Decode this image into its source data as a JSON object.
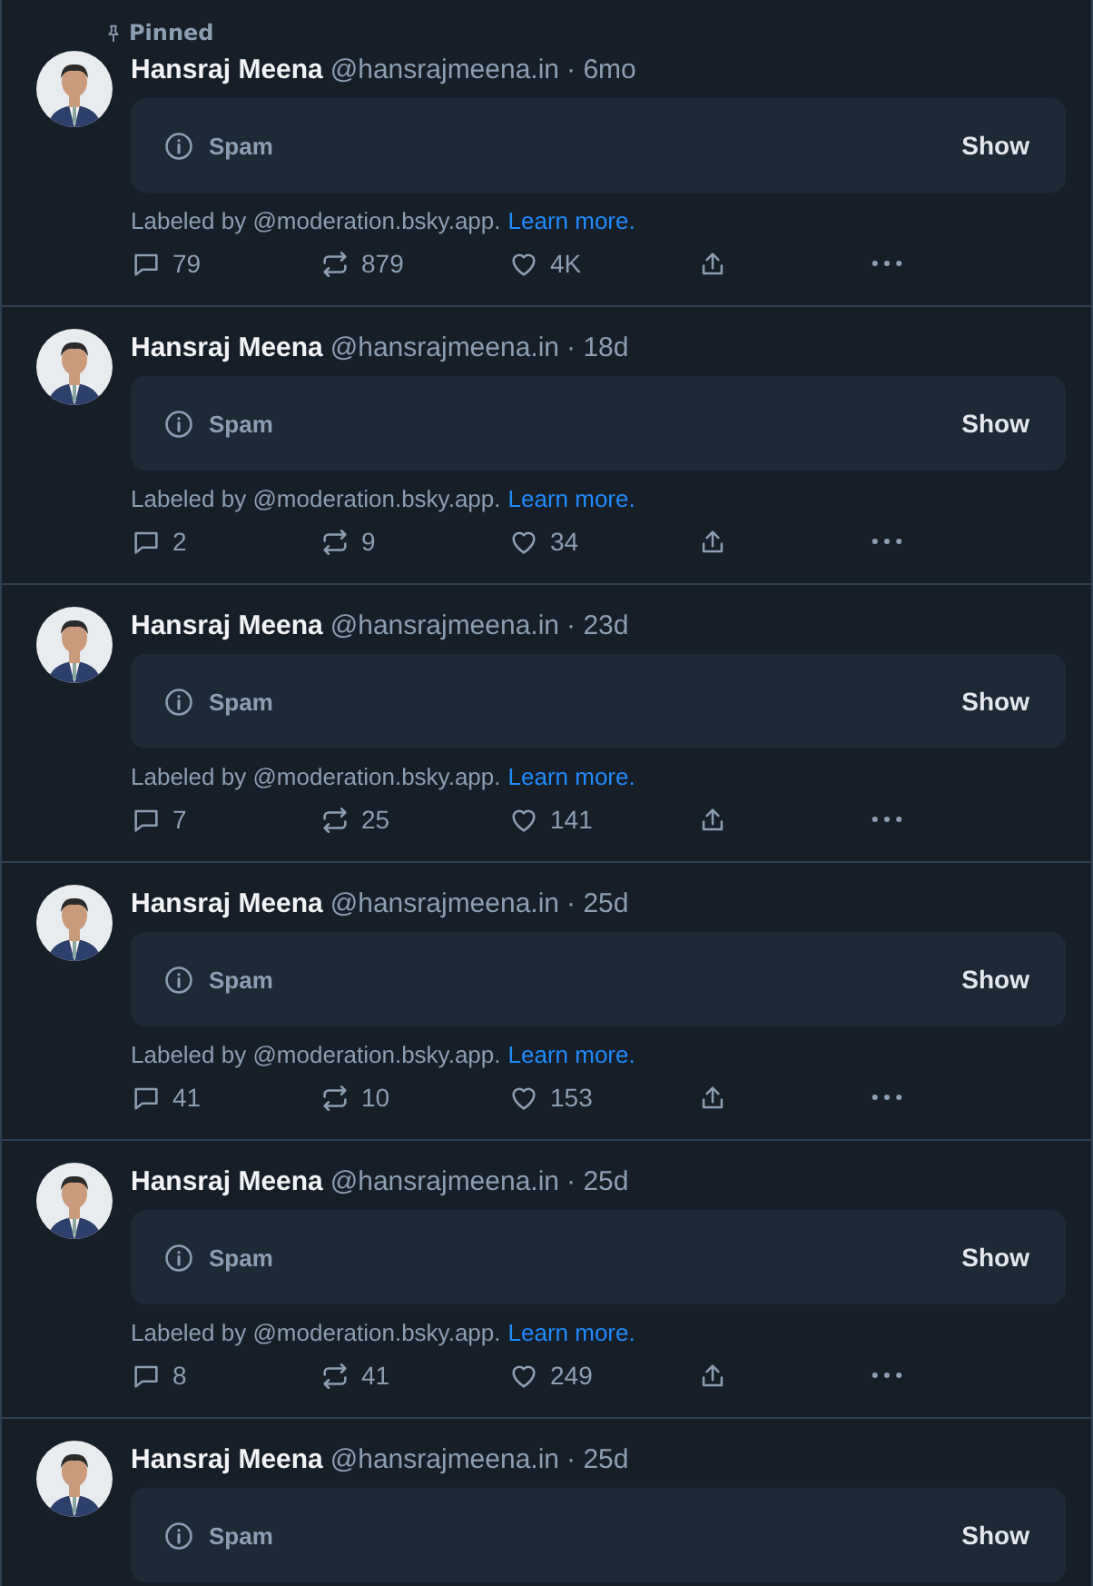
{
  "posts": [
    {
      "pinned_label": "Pinned",
      "name": "Hansraj Meena",
      "handle": "@hansrajmeena.in",
      "time": "· 6mo",
      "warning": "Spam",
      "show": "Show",
      "labeled_by": "Labeled by @moderation.bsky.app.",
      "learn_more": "Learn more.",
      "replies": "79",
      "reposts": "879",
      "likes": "4K"
    },
    {
      "name": "Hansraj Meena",
      "handle": "@hansrajmeena.in",
      "time": "· 18d",
      "warning": "Spam",
      "show": "Show",
      "labeled_by": "Labeled by @moderation.bsky.app.",
      "learn_more": "Learn more.",
      "replies": "2",
      "reposts": "9",
      "likes": "34"
    },
    {
      "name": "Hansraj Meena",
      "handle": "@hansrajmeena.in",
      "time": "· 23d",
      "warning": "Spam",
      "show": "Show",
      "labeled_by": "Labeled by @moderation.bsky.app.",
      "learn_more": "Learn more.",
      "replies": "7",
      "reposts": "25",
      "likes": "141"
    },
    {
      "name": "Hansraj Meena",
      "handle": "@hansrajmeena.in",
      "time": "· 25d",
      "warning": "Spam",
      "show": "Show",
      "labeled_by": "Labeled by @moderation.bsky.app.",
      "learn_more": "Learn more.",
      "replies": "41",
      "reposts": "10",
      "likes": "153"
    },
    {
      "name": "Hansraj Meena",
      "handle": "@hansrajmeena.in",
      "time": "· 25d",
      "warning": "Spam",
      "show": "Show",
      "labeled_by": "Labeled by @moderation.bsky.app.",
      "learn_more": "Learn more.",
      "replies": "8",
      "reposts": "41",
      "likes": "249"
    },
    {
      "name": "Hansraj Meena",
      "handle": "@hansrajmeena.in",
      "time": "· 25d",
      "warning": "Spam",
      "show": "Show"
    }
  ]
}
